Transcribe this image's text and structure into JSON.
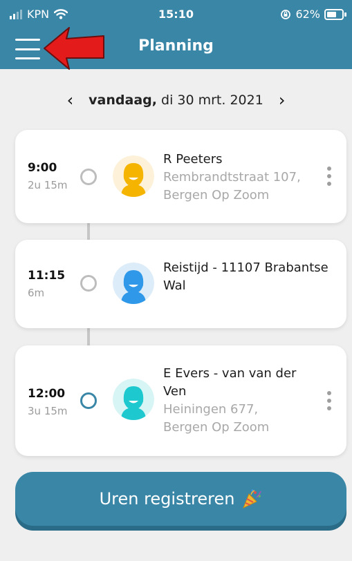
{
  "status_bar": {
    "carrier": "KPN",
    "time": "15:10",
    "battery": "62%"
  },
  "app_bar": {
    "title": "Planning",
    "menu_icon": "hamburger-menu-icon"
  },
  "date_nav": {
    "prev_label": "‹",
    "next_label": "›",
    "today_label": "vandaag,",
    "date_label": "di 30 mrt. 2021"
  },
  "appointments": [
    {
      "time": "9:00",
      "duration": "2u 15m",
      "name": "R Peeters",
      "address_line1": "Rembrandtstraat 107,",
      "address_line2": "Bergen Op Zoom",
      "avatar_color": "#f5b400",
      "has_menu": true
    },
    {
      "time": "11:15",
      "duration": "6m",
      "name": "Reistijd - 11107 Brabantse Wal",
      "avatar_color": "#2f98e8",
      "has_menu": false
    },
    {
      "time": "12:00",
      "duration": "3u 15m",
      "name": "E Evers - van van der Ven",
      "address_line1": "Heiningen 677,",
      "address_line2": "Bergen Op Zoom",
      "avatar_color": "#1ec8cf",
      "has_menu": true
    }
  ],
  "register_button": {
    "label": "Uren registreren",
    "icon": "party-popper-icon"
  },
  "colors": {
    "primary": "#3a86a6",
    "background": "#efefef",
    "annotation_arrow": "#e31b1b"
  }
}
